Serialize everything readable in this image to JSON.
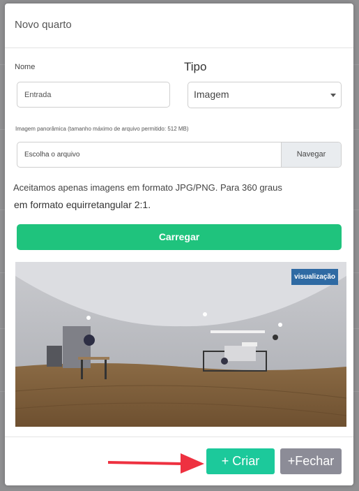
{
  "modal": {
    "title": "Novo quarto",
    "name_label": "Nome",
    "name_placeholder": "Entrada",
    "type_label": "Tipo",
    "type_value": "Imagem",
    "file_help": "Imagem panorâmica (tamanho máximo de arquivo permitido: 512 MB)",
    "file_placeholder": "Escolha o arquivo",
    "browse_label": "Navegar",
    "info_line1": "Aceitamos apenas imagens em formato JPG/PNG. Para 360 graus",
    "info_line2": "em formato equirretangular 2:1.",
    "upload_label": "Carregar",
    "preview_badge": "visualização",
    "create_label": "+ Criar",
    "close_label": "+Fechar"
  },
  "colors": {
    "upload": "#1fc37d",
    "create": "#1cc99b",
    "close": "#8c8c97",
    "badge": "#2f6aa3",
    "arrow": "#ee3140"
  },
  "icons": {
    "dropdown": "chevron-down-icon",
    "arrow": "pointer-arrow"
  }
}
